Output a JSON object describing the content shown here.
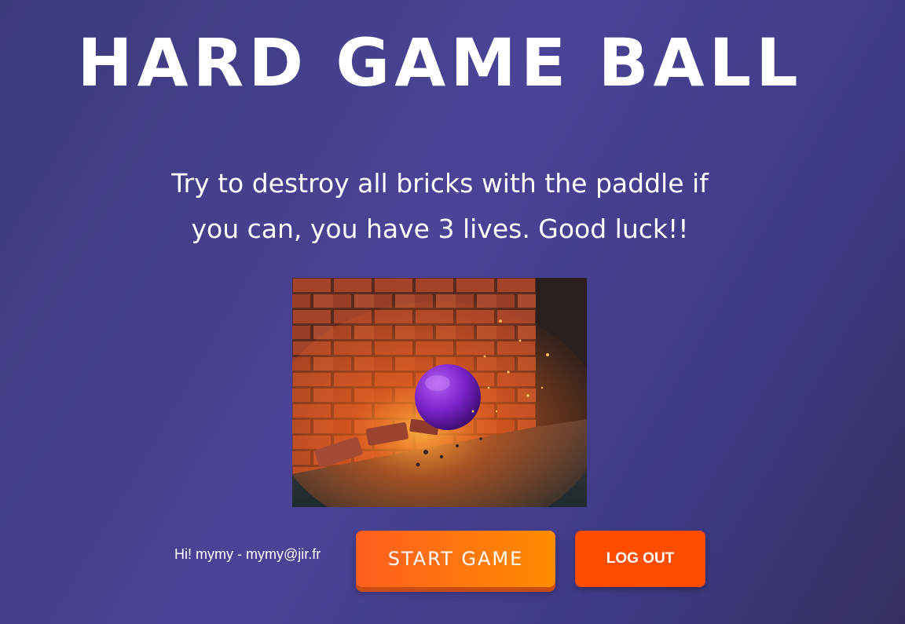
{
  "header": {
    "title": "HARD GAME BALL",
    "subtitle": "Try to destroy all bricks with the paddle if you can, you have 3 lives. Good luck!!"
  },
  "hero_image": {
    "subject": "purple ball smashing a brick wall"
  },
  "user": {
    "greeting": "Hi! mymy - mymy@jir.fr"
  },
  "actions": {
    "start_label": "START GAME",
    "logout_label": "LOG OUT"
  },
  "colors": {
    "background": "#4b4396",
    "start_button": "#ff7a10",
    "logout_button": "#ff4d00",
    "ball": "#8a2be2"
  }
}
